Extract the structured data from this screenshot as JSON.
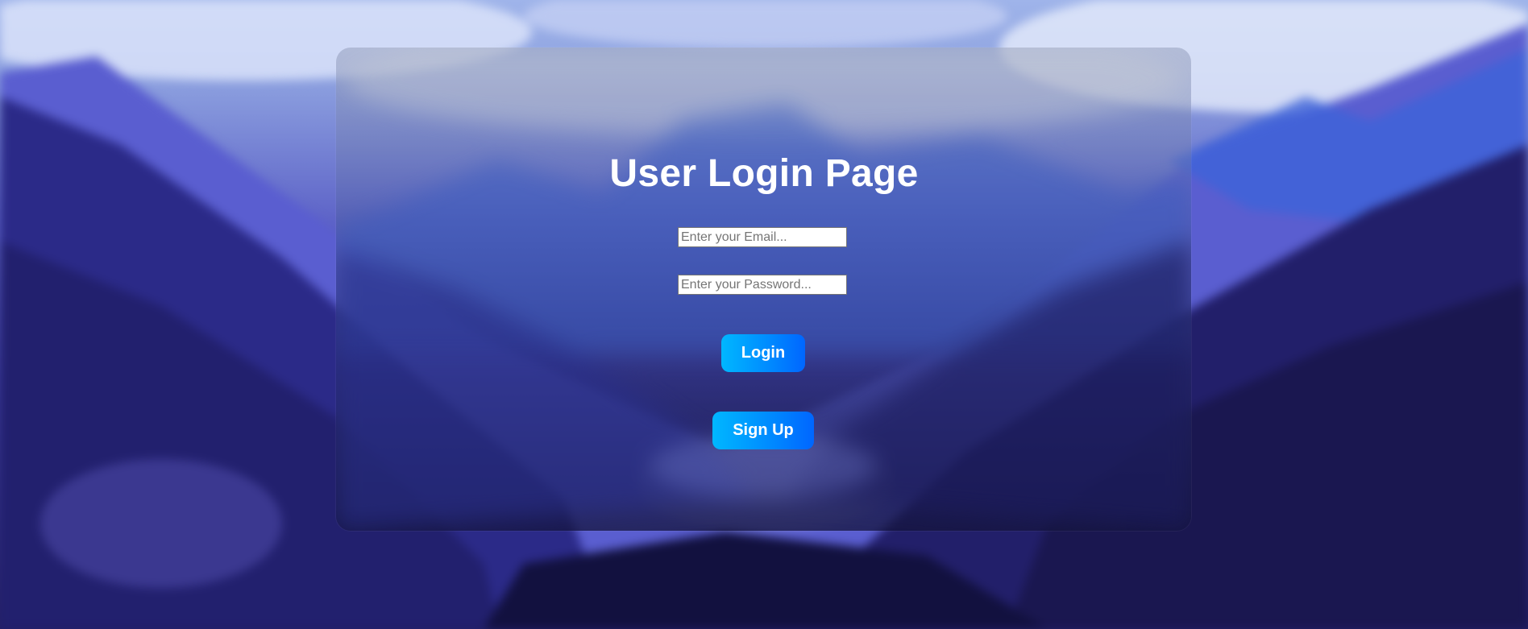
{
  "page": {
    "title": "User Login Page"
  },
  "form": {
    "email_placeholder": "Enter your Email...",
    "email_value": "",
    "password_placeholder": "Enter your Password...",
    "password_value": "",
    "login_label": "Login",
    "signup_label": "Sign Up"
  },
  "colors": {
    "button_gradient_start": "#00b7ff",
    "button_gradient_end": "#0066ff",
    "title_text": "#ffffff"
  }
}
